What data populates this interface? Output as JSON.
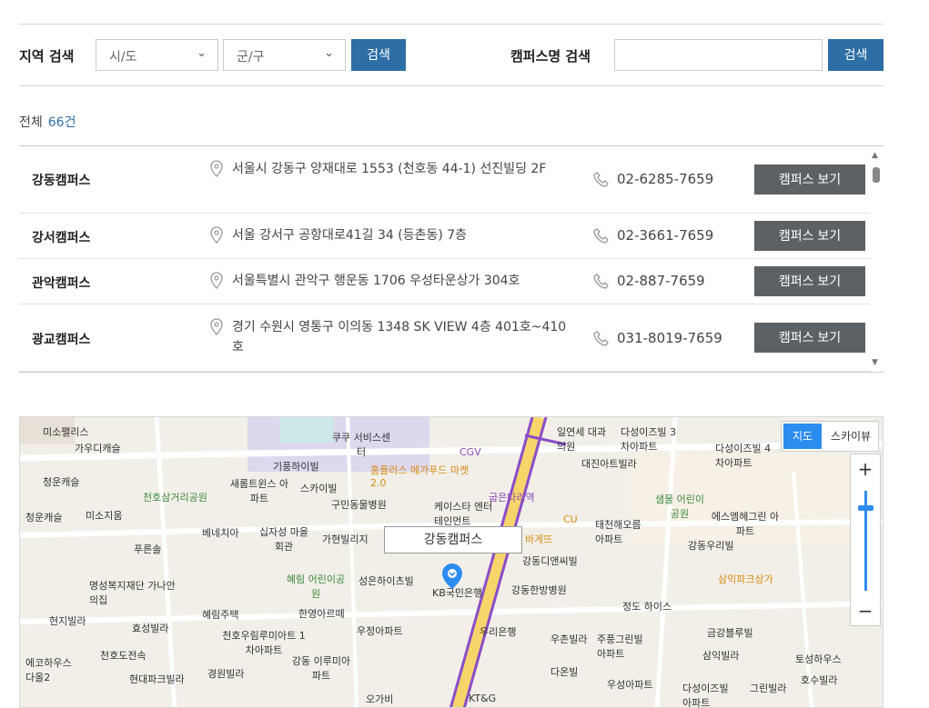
{
  "search": {
    "region_label": "지역 검색",
    "sido_value": "시/도",
    "gungu_value": "군/구",
    "region_button": "검색",
    "campus_label": "캠퍼스명 검색",
    "campus_input_value": "",
    "campus_button": "검색"
  },
  "summary": {
    "total_label": "전체",
    "total_count": "66건"
  },
  "campuses": [
    {
      "name": "강동캠퍼스",
      "address": "서울시 강동구 양재대로 1553 (천호동 44-1) 선진빌딩 2F",
      "phone": "02-6285-7659",
      "button": "캠퍼스 보기"
    },
    {
      "name": "강서캠퍼스",
      "address": "서울 강서구 공항대로41길 34 (등촌동) 7층",
      "phone": "02-3661-7659",
      "button": "캠퍼스 보기"
    },
    {
      "name": "관악캠퍼스",
      "address": "서울특별시 관악구 행운동 1706 우성타운상가 304호",
      "phone": "02-887-7659",
      "button": "캠퍼스 보기"
    },
    {
      "name": "광교캠퍼스",
      "address": "경기 수원시 영통구 이의동 1348 SK VIEW 4층 401호~410호",
      "phone": "031-8019-7659",
      "button": "캠퍼스 보기"
    }
  ],
  "map": {
    "marker_label": "강동캠퍼스",
    "type_map": "지도",
    "type_sky": "스카이뷰",
    "zoom_in": "+",
    "zoom_out": "−",
    "places": [
      "미소팰리스",
      "가우디캐슬",
      "청운캐슬",
      "천호삼거리공원",
      "청운캐슬",
      "미소지움",
      "베네치아",
      "푸른솔",
      "명성복지재단 가나안의집",
      "현지빌라",
      "효성빌라",
      "혜림주택",
      "천호우림루미아트 1차아파트",
      "에코하우스 다올2",
      "천호도전속",
      "현대파크빌라",
      "경원빌라",
      "강동 이루미아파트",
      "기풍하이빌",
      "새롬트윈스 아파트",
      "스카이빌",
      "구민동물병원",
      "십자성 마을회관",
      "가현빌리지",
      "혜림 어린이공원",
      "성은하이츠빌",
      "한영아르떼",
      "우정아파트",
      "쿠쿠 서비스센터",
      "CGV",
      "홈플러스 메가푸드 마켓 2.0",
      "케이스타 엔터테인먼트",
      "굽은다리역",
      "KB국민은행",
      "강동한방병원",
      "강동디앤씨빌",
      "우리은행",
      "KT&G",
      "오가비",
      "일연세 대과의원",
      "다성이즈빌 3차아파트",
      "대진아트빌라",
      "다성이즈빌 4차아파트",
      "샘물 어린이공원",
      "태천해오름 아파트",
      "에스엠헤그린 아파트",
      "강동우리빌",
      "삼익파크상가",
      "정도 하이스",
      "주풍그린빌 아파트",
      "우촌빌라",
      "금강블루빌",
      "삼익빌라",
      "다온빌",
      "우성아파트",
      "다성이즈빌 아파트",
      "그린빌라",
      "토성하우스",
      "호수빌라",
      "CU",
      "바게뜨"
    ]
  }
}
